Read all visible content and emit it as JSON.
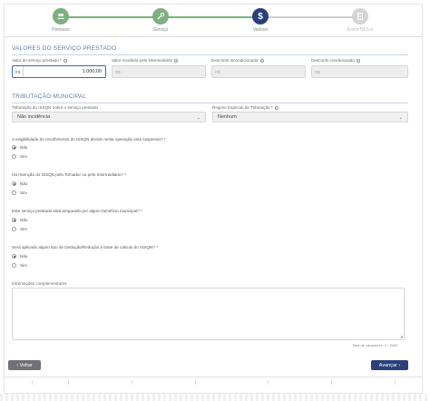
{
  "stepper": {
    "steps": [
      {
        "label": "Pessoas",
        "icon": "people-icon",
        "state": "done"
      },
      {
        "label": "Serviço",
        "icon": "wrench-icon",
        "state": "done"
      },
      {
        "label": "Valores",
        "icon": "dollar-icon",
        "state": "active",
        "glyph": "$"
      },
      {
        "label": "Emitir NFS-e",
        "icon": "document-icon",
        "state": "todo"
      }
    ]
  },
  "valores": {
    "title": "VALORES DO SERVIÇO PRESTADO",
    "valor_servico": {
      "label": "Valor do serviço prestado *",
      "prefix": "R$",
      "value": "1.000,00"
    },
    "valor_intermediario": {
      "label": "Valor recebido pelo intermediário",
      "prefix": "R$"
    },
    "desconto_incond": {
      "label": "Desconto incondicionado",
      "prefix": "R$"
    },
    "desconto_cond": {
      "label": "Desconto condicionado",
      "prefix": "R$"
    },
    "info_glyph": "i"
  },
  "tributacao": {
    "title": "TRIBUTAÇÃO MUNICIPAL",
    "trib_issqn": {
      "label": "Tributação do ISSQN sobre o serviço prestado",
      "value": "Não incidência"
    },
    "regime": {
      "label": "Regime Especial de Tributação *",
      "value": "Nenhum"
    },
    "chevron": "⌄"
  },
  "questions": [
    {
      "text": "A exigibilidade do recolhimento do ISSQN devido nesta operação está suspensa? *",
      "options": [
        "Não",
        "Sim"
      ],
      "selected": 0
    },
    {
      "text": "Há retenção do ISSQN pelo Tomador ou pelo Intermediário? *",
      "options": [
        "Não",
        "Sim"
      ],
      "selected": 0
    },
    {
      "text": "Este serviço prestado está amparado por algum benefício municipal? *",
      "options": [
        "Não",
        "Sim"
      ],
      "selected": 0
    },
    {
      "text": "Será aplicado algum tipo de Dedução/Redução à base de cálculo do ISSQN? *",
      "options": [
        "Não",
        "Sim"
      ],
      "selected": 0
    }
  ],
  "info": {
    "label": "Informações complementares",
    "counter": "Total de caracteres: 0 / 2000",
    "resize_glyph": "◢"
  },
  "nav": {
    "back_label": "‹ Voltar",
    "next_label": "Avançar ›"
  }
}
